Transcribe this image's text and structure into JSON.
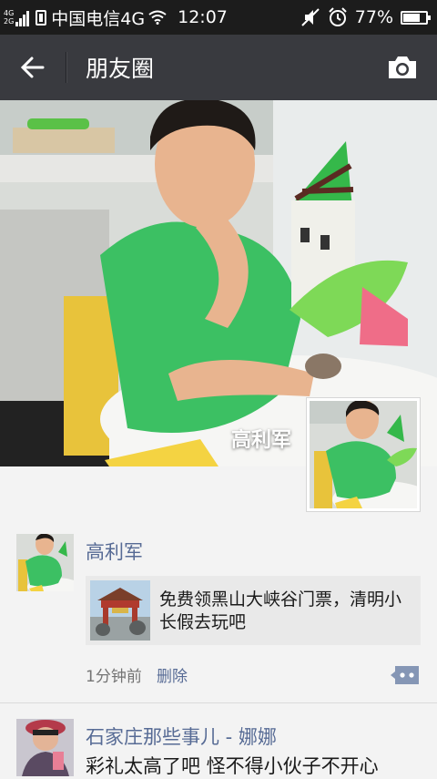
{
  "status_bar": {
    "net_top": "4G",
    "net_bottom": "2G",
    "carrier": "中国电信4G",
    "time": "12:07",
    "battery_percent": "77%",
    "battery_level": 0.77
  },
  "nav": {
    "title": "朋友圈",
    "back_icon": "back-arrow-icon",
    "camera_icon": "camera-icon"
  },
  "cover": {
    "user_name": "高利军"
  },
  "posts": [
    {
      "author": "高利军",
      "share_text": "免费领黑山大峡谷门票，清明小长假去玩吧",
      "time": "1分钟前",
      "delete_label": "删除"
    },
    {
      "author": "石家庄那些事儿 - 娜娜",
      "text": "彩礼太高了吧 怪不得小伙子不开心"
    }
  ],
  "colors": {
    "status_bar": "#1c1c1c",
    "nav_bar": "#393a3f",
    "link": "#576b95",
    "background": "#f3f3f3"
  }
}
